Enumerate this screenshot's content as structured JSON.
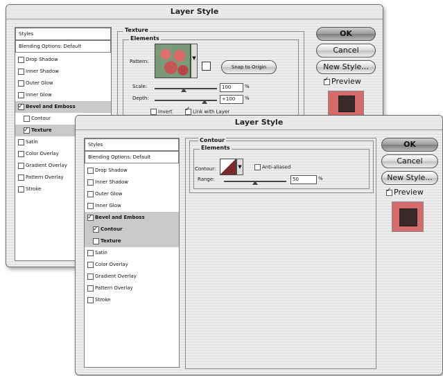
{
  "back_window": {
    "title": "Layer Style",
    "list": {
      "header": "Styles",
      "blending": "Blending Options: Default",
      "items": [
        {
          "label": "Drop Shadow",
          "checked": false
        },
        {
          "label": "Inner Shadow",
          "checked": false
        },
        {
          "label": "Outer Glow",
          "checked": false
        },
        {
          "label": "Inner Glow",
          "checked": false
        },
        {
          "label": "Bevel and Emboss",
          "checked": true
        },
        {
          "label": "Contour",
          "checked": false
        },
        {
          "label": "Texture",
          "checked": true
        },
        {
          "label": "Satin",
          "checked": false
        },
        {
          "label": "Color Overlay",
          "checked": false
        },
        {
          "label": "Gradient Overlay",
          "checked": false
        },
        {
          "label": "Pattern Overlay",
          "checked": false
        },
        {
          "label": "Stroke",
          "checked": false
        }
      ]
    },
    "section": "Texture",
    "elements": "Elements",
    "pattern_label": "Pattern:",
    "snap_button": "Snap to Origin",
    "scale_label": "Scale:",
    "scale_value": "100",
    "depth_label": "Depth:",
    "depth_value": "+100",
    "percent": "%",
    "invert_label": "Invert",
    "link_label": "Link with Layer",
    "buttons": {
      "ok": "OK",
      "cancel": "Cancel",
      "new_style": "New Style...",
      "preview": "Preview"
    }
  },
  "front_window": {
    "title": "Layer Style",
    "list": {
      "header": "Styles",
      "blending": "Blending Options: Default",
      "items": [
        {
          "label": "Drop Shadow",
          "checked": false
        },
        {
          "label": "Inner Shadow",
          "checked": false
        },
        {
          "label": "Outer Glow",
          "checked": false
        },
        {
          "label": "Inner Glow",
          "checked": false
        },
        {
          "label": "Bevel and Emboss",
          "checked": true
        },
        {
          "label": "Contour",
          "checked": true
        },
        {
          "label": "Texture",
          "checked": false
        },
        {
          "label": "Satin",
          "checked": false
        },
        {
          "label": "Color Overlay",
          "checked": false
        },
        {
          "label": "Gradient Overlay",
          "checked": false
        },
        {
          "label": "Pattern Overlay",
          "checked": false
        },
        {
          "label": "Stroke",
          "checked": false
        }
      ]
    },
    "section": "Contour",
    "elements": "Elements",
    "contour_label": "Contour:",
    "antialiased_label": "Anti-aliased",
    "range_label": "Range:",
    "range_value": "50",
    "percent": "%",
    "buttons": {
      "ok": "OK",
      "cancel": "Cancel",
      "new_style": "New Style...",
      "preview": "Preview"
    }
  },
  "colors": {
    "preview_bg": "#d66b6b",
    "preview_square": "#3a2a2a",
    "selection": "#c9c9c9"
  }
}
